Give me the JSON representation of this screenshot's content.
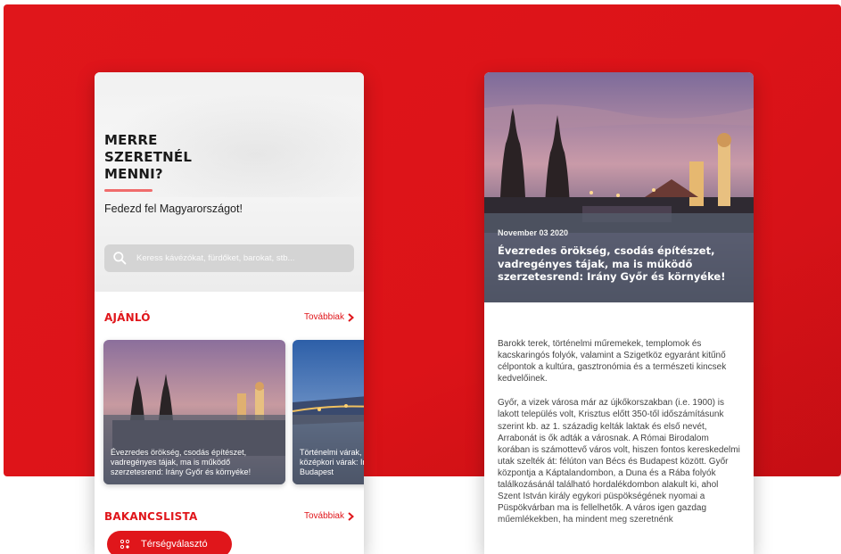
{
  "colors": {
    "brand_red": "#e0161b",
    "accent_rule": "#f06c6c",
    "search_bg": "#d4d4d4"
  },
  "left_screen": {
    "hero": {
      "title": "MERRE SZERETNÉL MENNI?",
      "subtitle": "Fedezd fel Magyarországot!"
    },
    "search": {
      "icon": "search-icon",
      "placeholder": "Keress kávézókat, fürdőket, barokat, stb..."
    },
    "featured": {
      "title": "AJÁNLÓ",
      "more_label": "Továbbiak",
      "cards": [
        {
          "text": "Évezredes örökség, csodás építészet, vadregényes tájak, ma is működő szerzetesrend: Irány Győr és környéke!"
        },
        {
          "text": "Történelmi várak, középkori várak: Irány Budapest"
        }
      ]
    },
    "bucketlist": {
      "title": "BAKANCSLISTA",
      "more_label": "Továbbiak",
      "region_button_label": "Térségválasztó"
    }
  },
  "right_screen": {
    "article": {
      "date": "November 03 2020",
      "title": "Évezredes örökség, csodás építészet, vadregényes tájak, ma is működő szerzetesrend: Irány Győr és környéke!",
      "paragraphs": [
        "Barokk terek, történelmi műremekek, templomok és kacskaringós folyók, valamint a Szigetköz egyaránt kitűnő célpontok a kultúra, gasztronómia és a természeti kincsek kedvelőinek.",
        "Győr, a vizek városa már az újkőkorszakban (i.e. 1900) is lakott település volt, Krisztus előtt 350-től időszámításunk szerint kb. az 1. századig kelták laktak és első nevét, Arrabonát is ők adták a városnak. A Római Birodalom korában is számottevő város volt, hiszen fontos kereskedelmi utak szelték át: félúton van Bécs és Budapest között. Győr központja a Káptalandombon, a Duna és a Rába folyók találkozásánál található hordalékdombon alakult ki, ahol Szent István király egykori püspökségének nyomai a Püspökvárban ma is fellelhetők. A város igen gazdag műemlékekben, ha mindent meg szeretnénk"
      ]
    }
  }
}
